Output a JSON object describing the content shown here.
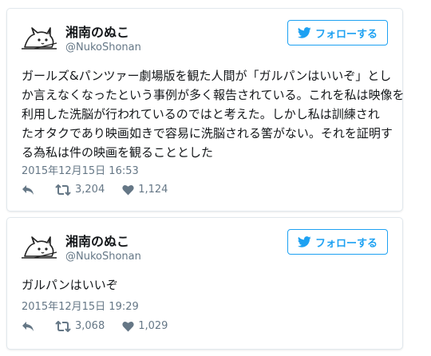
{
  "tweets": [
    {
      "name": "湘南のぬこ",
      "handle": "@NukoShonan",
      "follow_label": "フォローする",
      "text_lines": [
        "ガールズ&パンツァー劇場版を観た人間が「ガルパンはいいぞ」とし",
        "か言えなくなったという事例が多く報告されている。これを私は映像を",
        "利用した洗脳が行われているのではと考えた。しかし私は訓練され",
        "たオタクであり映画如きで容易に洗脳される筈がない。それを証明す",
        "る為私は件の映画を観ることとした"
      ],
      "date": "2015年12月15日 16:53",
      "retweets": "3,204",
      "likes": "1,124"
    },
    {
      "name": "湘南のぬこ",
      "handle": "@NukoShonan",
      "follow_label": "フォローする",
      "text_lines": [
        "ガルパンはいいぞ"
      ],
      "date": "2015年12月15日 19:29",
      "retweets": "3,068",
      "likes": "1,029"
    }
  ],
  "icons": {
    "bird": "twitter-bird-icon",
    "reply": "reply-icon",
    "retweet": "retweet-icon",
    "like": "heart-icon",
    "avatar": "cat-avatar"
  },
  "colors": {
    "accent": "#1da1f2",
    "secondary_text": "#657786",
    "border": "#e1e8ed"
  }
}
